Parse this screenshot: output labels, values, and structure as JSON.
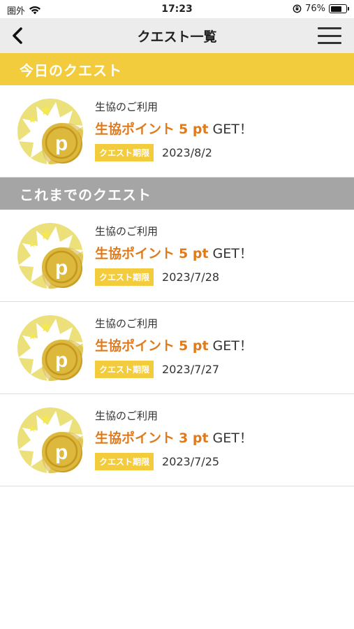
{
  "status_bar": {
    "carrier": "圏外",
    "time": "17:23",
    "battery_percent": "76%",
    "battery_level": 0.76
  },
  "nav": {
    "title": "クエスト一覧",
    "back_icon": "chevron-left-icon",
    "menu_icon": "hamburger-menu-icon"
  },
  "sections": {
    "today": "今日のクエスト",
    "past": "これまでのクエスト"
  },
  "colors": {
    "accent_yellow": "#f3cc3e",
    "reward_orange": "#e07a1c",
    "past_header_gray": "#a5a5a5"
  },
  "today_quests": [
    {
      "category": "生協のご利用",
      "reward_name": "生協ポイント",
      "points": "5 pt",
      "suffix": "GET！",
      "deadline_label": "クエスト期限",
      "deadline": "2023/8/2"
    }
  ],
  "past_quests": [
    {
      "category": "生協のご利用",
      "reward_name": "生協ポイント",
      "points": "5 pt",
      "suffix": "GET！",
      "deadline_label": "クエスト期限",
      "deadline": "2023/7/28"
    },
    {
      "category": "生協のご利用",
      "reward_name": "生協ポイント",
      "points": "5 pt",
      "suffix": "GET！",
      "deadline_label": "クエスト期限",
      "deadline": "2023/7/27"
    },
    {
      "category": "生協のご利用",
      "reward_name": "生協ポイント",
      "points": "3 pt",
      "suffix": "GET！",
      "deadline_label": "クエスト期限",
      "deadline": "2023/7/25"
    }
  ]
}
